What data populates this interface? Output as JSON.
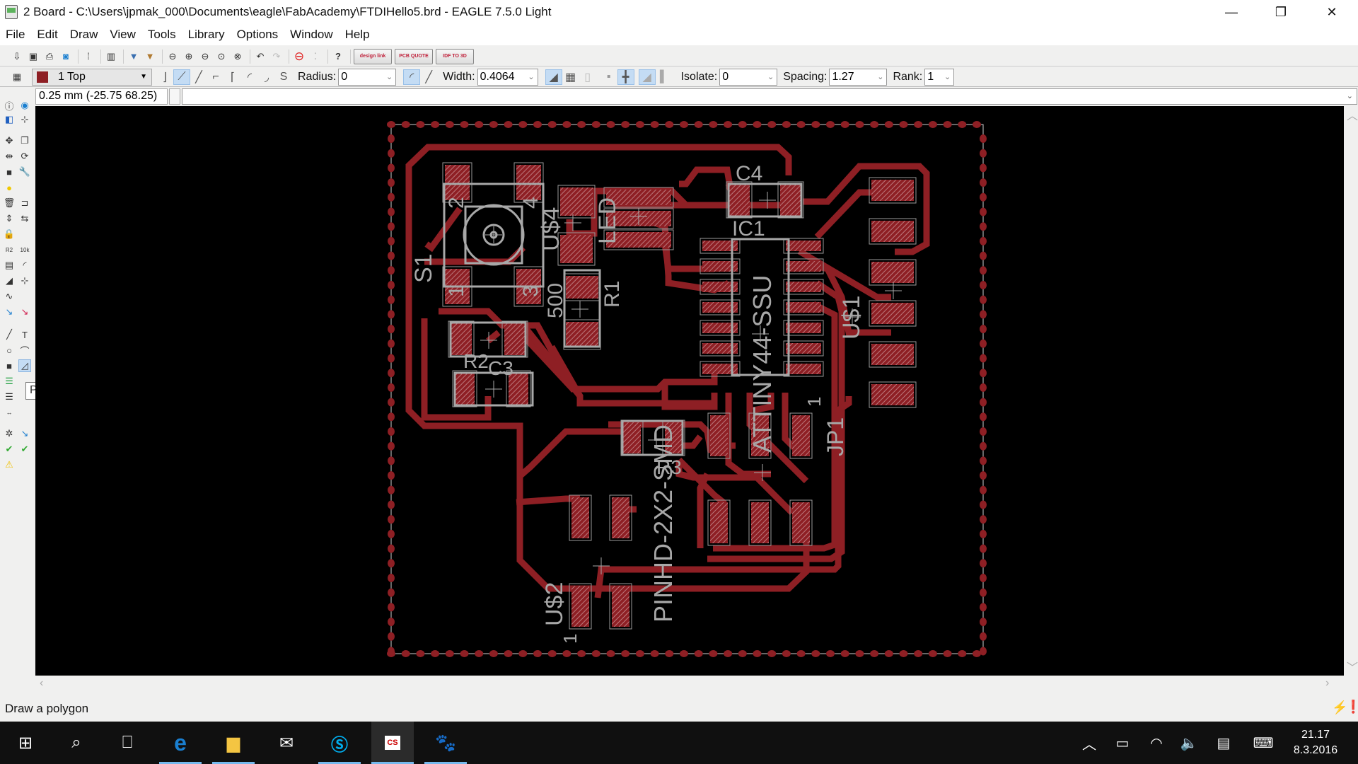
{
  "window": {
    "title": "2 Board - C:\\Users\\jpmak_000\\Documents\\eagle\\FabAcademy\\FTDIHello5.brd - EAGLE 7.5.0 Light",
    "minimize_icon": "—",
    "restore_icon": "❐",
    "close_icon": "✕"
  },
  "menu": [
    "File",
    "Edit",
    "Draw",
    "View",
    "Tools",
    "Library",
    "Options",
    "Window",
    "Help"
  ],
  "toolbar1": {
    "buttons": [
      "open",
      "save",
      "print",
      "cam",
      "script",
      "ulp",
      "sch",
      "brd",
      "zoom-fit",
      "zoom-in",
      "zoom-out",
      "zoom-select",
      "zoom-redraw",
      "undo",
      "redo",
      "stop",
      "go",
      "help"
    ],
    "ext_buttons": [
      "design link",
      "PCB QUOTE",
      "IDF TO 3D"
    ]
  },
  "toolbar2": {
    "layer": "1 Top",
    "layer_color": "#8e1f24",
    "radius_label": "Radius:",
    "radius_value": "0",
    "width_label": "Width:",
    "width_value": "0.4064",
    "isolate_label": "Isolate:",
    "isolate_value": "0",
    "spacing_label": "Spacing:",
    "spacing_value": "1.27",
    "rank_label": "Rank:",
    "rank_value": "1"
  },
  "command": {
    "coordinate": "0.25 mm (-25.75 68.25)",
    "input_value": ""
  },
  "left_tools": {
    "tooltip": "Polygon",
    "active_tool": "polygon"
  },
  "board": {
    "copper_color": "#8e1f24",
    "silk_color": "#a8a8a8",
    "labels": {
      "s1": "S1",
      "us4": "U$4",
      "led": "LED",
      "c4": "C4",
      "ic1": "IC1",
      "attiny": "ATTINY44-SSU",
      "us1": "U$1",
      "r1": "R1",
      "r1_val": "500",
      "r2": "R2",
      "c3": "C3",
      "r3": "R3",
      "pinhd": "PINHD-2X2-SMD",
      "jp1": "JP1",
      "jp1_pin1": "1",
      "us2": "U$2",
      "us2_pin1": "1",
      "sw_pin1": "1",
      "sw_pin2": "2",
      "sw_pin3": "3",
      "sw_pin4": "4"
    }
  },
  "status": {
    "text": "Draw a polygon"
  },
  "taskbar": {
    "apps": [
      "start",
      "search",
      "task-view",
      "edge",
      "file-explorer",
      "mail",
      "skype",
      "eagle",
      "gimp"
    ],
    "time": "21.17",
    "date": "8.3.2016"
  }
}
